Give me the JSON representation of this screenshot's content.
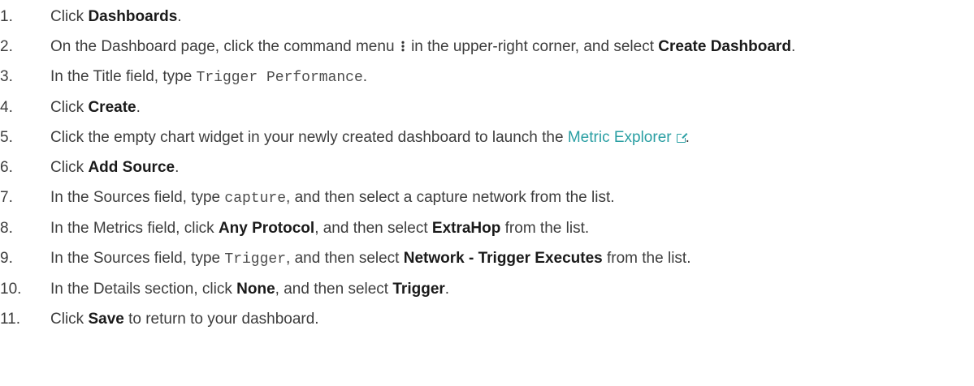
{
  "steps": [
    {
      "num": "1.",
      "parts": [
        {
          "t": "text",
          "v": "Click "
        },
        {
          "t": "bold",
          "v": "Dashboards"
        },
        {
          "t": "text",
          "v": "."
        }
      ]
    },
    {
      "num": "2.",
      "parts": [
        {
          "t": "text",
          "v": "On the Dashboard page, click the command menu "
        },
        {
          "t": "icon",
          "v": "kebab-menu-icon"
        },
        {
          "t": "text",
          "v": " in the upper-right corner, and select "
        },
        {
          "t": "bold",
          "v": "Create Dashboard"
        },
        {
          "t": "text",
          "v": "."
        }
      ]
    },
    {
      "num": "3.",
      "parts": [
        {
          "t": "text",
          "v": "In the Title field, type "
        },
        {
          "t": "code",
          "v": "Trigger Performance"
        },
        {
          "t": "text",
          "v": "."
        }
      ]
    },
    {
      "num": "4.",
      "parts": [
        {
          "t": "text",
          "v": "Click "
        },
        {
          "t": "bold",
          "v": "Create"
        },
        {
          "t": "text",
          "v": "."
        }
      ]
    },
    {
      "num": "5.",
      "parts": [
        {
          "t": "text",
          "v": "Click the empty chart widget in your newly created dashboard to launch the "
        },
        {
          "t": "link",
          "v": "Metric Explorer"
        },
        {
          "t": "text",
          "v": "."
        }
      ]
    },
    {
      "num": "6.",
      "parts": [
        {
          "t": "text",
          "v": "Click "
        },
        {
          "t": "bold",
          "v": "Add Source"
        },
        {
          "t": "text",
          "v": "."
        }
      ]
    },
    {
      "num": "7.",
      "parts": [
        {
          "t": "text",
          "v": "In the Sources field, type "
        },
        {
          "t": "code",
          "v": "capture"
        },
        {
          "t": "text",
          "v": ", and then select a capture network from the list."
        }
      ]
    },
    {
      "num": "8.",
      "parts": [
        {
          "t": "text",
          "v": "In the Metrics field, click "
        },
        {
          "t": "bold",
          "v": "Any Protocol"
        },
        {
          "t": "text",
          "v": ", and then select "
        },
        {
          "t": "bold",
          "v": "ExtraHop"
        },
        {
          "t": "text",
          "v": " from the list."
        }
      ]
    },
    {
      "num": "9.",
      "parts": [
        {
          "t": "text",
          "v": "In the Sources field, type "
        },
        {
          "t": "code",
          "v": "Trigger"
        },
        {
          "t": "text",
          "v": ", and then select "
        },
        {
          "t": "bold",
          "v": "Network - Trigger Executes"
        },
        {
          "t": "text",
          "v": " from the list."
        }
      ]
    },
    {
      "num": "10.",
      "parts": [
        {
          "t": "text",
          "v": "In the Details section, click "
        },
        {
          "t": "bold",
          "v": "None"
        },
        {
          "t": "text",
          "v": ", and then select "
        },
        {
          "t": "bold",
          "v": "Trigger"
        },
        {
          "t": "text",
          "v": "."
        }
      ]
    },
    {
      "num": "11.",
      "parts": [
        {
          "t": "text",
          "v": "Click "
        },
        {
          "t": "bold",
          "v": "Save"
        },
        {
          "t": "text",
          "v": " to return to your dashboard."
        }
      ]
    }
  ],
  "colors": {
    "text": "#3d3d3d",
    "bold": "#1a1a1a",
    "link": "#2a9fa3",
    "code": "#4d4d4d"
  }
}
